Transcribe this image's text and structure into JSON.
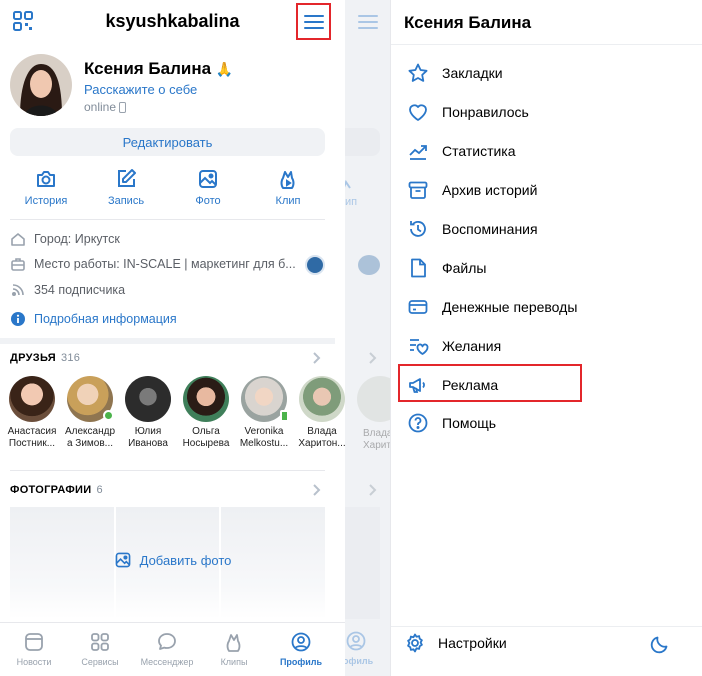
{
  "left_panel": {
    "username": "ksyushkabalina",
    "profile": {
      "name": "Ксения Балина",
      "emoji": "🙏",
      "about_link": "Расскажите о себе",
      "status": "online"
    },
    "edit_button": "Редактировать",
    "actions": [
      {
        "label": "История",
        "icon": "camera-icon"
      },
      {
        "label": "Запись",
        "icon": "edit-icon"
      },
      {
        "label": "Фото",
        "icon": "photo-icon"
      },
      {
        "label": "Клип",
        "icon": "clip-icon"
      }
    ],
    "info": {
      "city": "Город: Иркутск",
      "work": "Место работы: IN-SCALE | маркетинг для б...",
      "followers": "354 подписчика",
      "details_link": "Подробная информация"
    },
    "friends": {
      "title": "ДРУЗЬЯ",
      "count": "316",
      "items": [
        {
          "name_line1": "Анастасия",
          "name_line2": "Постник...",
          "badge": ""
        },
        {
          "name_line1": "Александр",
          "name_line2": "а Зимов...",
          "badge": "online"
        },
        {
          "name_line1": "Юлия",
          "name_line2": "Иванова",
          "badge": ""
        },
        {
          "name_line1": "Ольга",
          "name_line2": "Носырева",
          "badge": ""
        },
        {
          "name_line1": "Veronika",
          "name_line2": "Melkostu...",
          "badge": "mobile"
        },
        {
          "name_line1": "Влада",
          "name_line2": "Харитон...",
          "badge": ""
        }
      ]
    },
    "photos": {
      "title": "ФОТОГРАФИИ",
      "count": "6",
      "add_label": "Добавить фото"
    },
    "tabbar": [
      {
        "label": "Новости",
        "icon": "news-icon",
        "active": false
      },
      {
        "label": "Сервисы",
        "icon": "services-icon",
        "active": false
      },
      {
        "label": "Мессенджер",
        "icon": "messenger-icon",
        "active": false
      },
      {
        "label": "Клипы",
        "icon": "clips-icon",
        "active": false
      },
      {
        "label": "Профиль",
        "icon": "profile-icon",
        "active": true
      }
    ]
  },
  "strip": {
    "action_label": "ип",
    "friend_label_line1": "Влада",
    "friend_label_line2": "Харитон",
    "tab_label": "офиль"
  },
  "menu": {
    "title": "Ксения Балина",
    "items": [
      {
        "label": "Закладки",
        "icon": "star-icon"
      },
      {
        "label": "Понравилось",
        "icon": "heart-icon"
      },
      {
        "label": "Статистика",
        "icon": "chart-icon"
      },
      {
        "label": "Архив историй",
        "icon": "archive-icon"
      },
      {
        "label": "Воспоминания",
        "icon": "history-icon"
      },
      {
        "label": "Файлы",
        "icon": "file-icon"
      },
      {
        "label": "Денежные переводы",
        "icon": "money-icon"
      },
      {
        "label": "Желания",
        "icon": "wishlist-icon"
      },
      {
        "label": "Реклама",
        "icon": "megaphone-icon"
      },
      {
        "label": "Помощь",
        "icon": "help-icon"
      }
    ],
    "settings": "Настройки"
  },
  "colors": {
    "accent": "#2a77c9",
    "highlight": "#e3262b",
    "secondary_text": "#818c99"
  }
}
